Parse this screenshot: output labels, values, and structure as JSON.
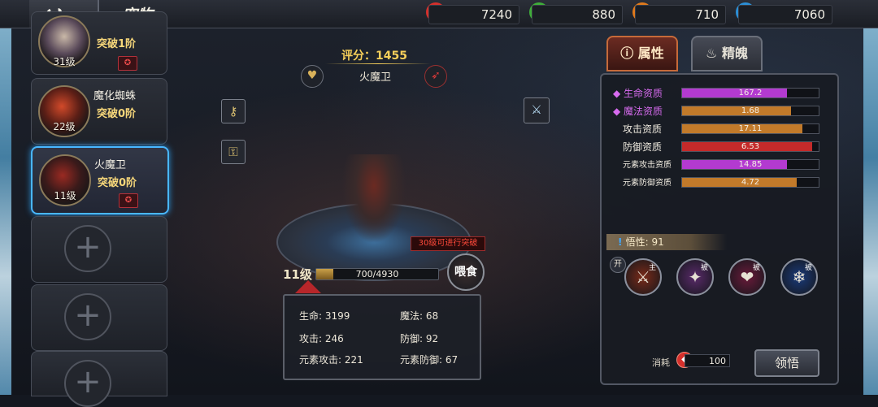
{
  "header": {
    "back_icon": "↩",
    "title": "宠物",
    "resources": [
      {
        "icon": "red-gem-icon",
        "color": "#d6302c",
        "value": "7240"
      },
      {
        "icon": "green-gem-icon",
        "color": "#3fae3a",
        "value": "880"
      },
      {
        "icon": "lightning-icon",
        "color": "#e07a1c",
        "value": "710"
      },
      {
        "icon": "snowflake-icon",
        "color": "#2c8fd6",
        "value": "7060"
      }
    ]
  },
  "pets": [
    {
      "name": "",
      "stage": "突破1阶",
      "level": "31级"
    },
    {
      "name": "魔化蜘蛛",
      "stage": "突破0阶",
      "level": "22级"
    },
    {
      "name": "火魔卫",
      "stage": "突破0阶",
      "level": "11级"
    }
  ],
  "center": {
    "score": "评分：1455",
    "pet_title": "火魔卫",
    "tip": "30级可进行突破",
    "level": "11级",
    "exp_text": "700/4930",
    "exp_progress": 0.142,
    "feed_label": "喂食",
    "stats": [
      {
        "label": "生命: 3199"
      },
      {
        "label": "魔法: 68"
      },
      {
        "label": "攻击: 246"
      },
      {
        "label": "防御: 92"
      },
      {
        "label": "元素攻击: 221"
      },
      {
        "label": "元素防御: 67"
      }
    ]
  },
  "tabs": {
    "attr": "属性",
    "soul": "精魄"
  },
  "qualities": [
    {
      "label": "生命资质",
      "value": "167.2",
      "fill": 0.77,
      "color": "#b33ad0",
      "label_color": "#d86bf0",
      "marker": "◆"
    },
    {
      "label": "魔法资质",
      "value": "1.68",
      "fill": 0.8,
      "color": "#c27a2a",
      "label_color": "#d86bf0",
      "marker": "◆"
    },
    {
      "label": "攻击资质",
      "value": "17.11",
      "fill": 0.88,
      "color": "#c27a2a",
      "label_color": "#f0ebe0",
      "marker": ""
    },
    {
      "label": "防御资质",
      "value": "6.53",
      "fill": 0.95,
      "color": "#c42a2a",
      "label_color": "#f0ebe0",
      "marker": ""
    },
    {
      "label": "元素攻击资质",
      "value": "14.85",
      "fill": 0.77,
      "color": "#b33ad0",
      "label_color": "#f0ebe0",
      "marker": ""
    },
    {
      "label": "元素防御资质",
      "value": "4.72",
      "fill": 0.84,
      "color": "#c27a2a",
      "label_color": "#f0ebe0",
      "marker": ""
    }
  ],
  "wuxing": "悟性: 91",
  "skills": {
    "toggle": "开",
    "items": [
      {
        "tag": "主",
        "icon": "flame-warrior-icon",
        "glyph": "⚔",
        "bg": "#7a2a18"
      },
      {
        "tag": "被",
        "icon": "flame-slash-icon",
        "glyph": "✦",
        "bg": "#5a2a6a"
      },
      {
        "tag": "被",
        "icon": "heart-icon",
        "glyph": "❤",
        "bg": "#6a1a3a"
      },
      {
        "tag": "被",
        "icon": "ice-up-icon",
        "glyph": "❄",
        "bg": "#1a3a7a"
      }
    ]
  },
  "footer": {
    "consume_label": "消耗",
    "consume_value": "100",
    "learn_label": "领悟"
  }
}
